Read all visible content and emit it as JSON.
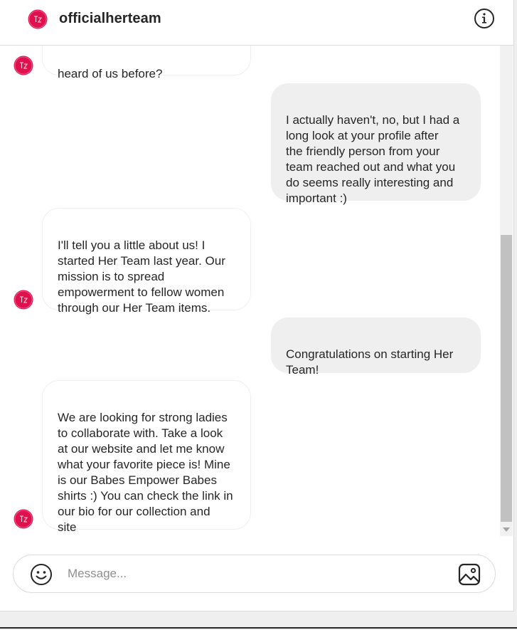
{
  "header": {
    "username": "officialherteam"
  },
  "thread": {
    "messages": [
      {
        "side": "in",
        "text": "heard of us before?"
      },
      {
        "side": "out",
        "text": "I actually haven't, no, but I had a\nlong look at your profile after\nthe friendly person from your\nteam reached out and what you\ndo seems really interesting and\nimportant :)"
      },
      {
        "side": "in",
        "text": "I'll tell you a little about us! I\nstarted Her Team last year. Our\nmission is to spread\nempowerment to fellow women\nthrough our Her Team items."
      },
      {
        "side": "out",
        "text": "Congratulations on starting Her\nTeam!"
      },
      {
        "side": "in",
        "text": "We are looking for strong ladies\nto collaborate with. Take a look\nat our website and let me know\nwhat your favorite piece is! Mine\nis our Babes Empower Babes\nshirts :) You can check the link in\nour bio for our collection and\nsite"
      }
    ]
  },
  "composer": {
    "value": "",
    "placeholder": "Message..."
  },
  "icons": {
    "avatar": "her-team-logo",
    "info": "info-icon",
    "emoji": "emoji-icon",
    "image": "image-icon"
  },
  "colors": {
    "brand": "#e0104f",
    "outgoing_bubble": "#efefef",
    "incoming_border": "#efefef",
    "text": "#262626",
    "placeholder": "#8e8e8e"
  }
}
